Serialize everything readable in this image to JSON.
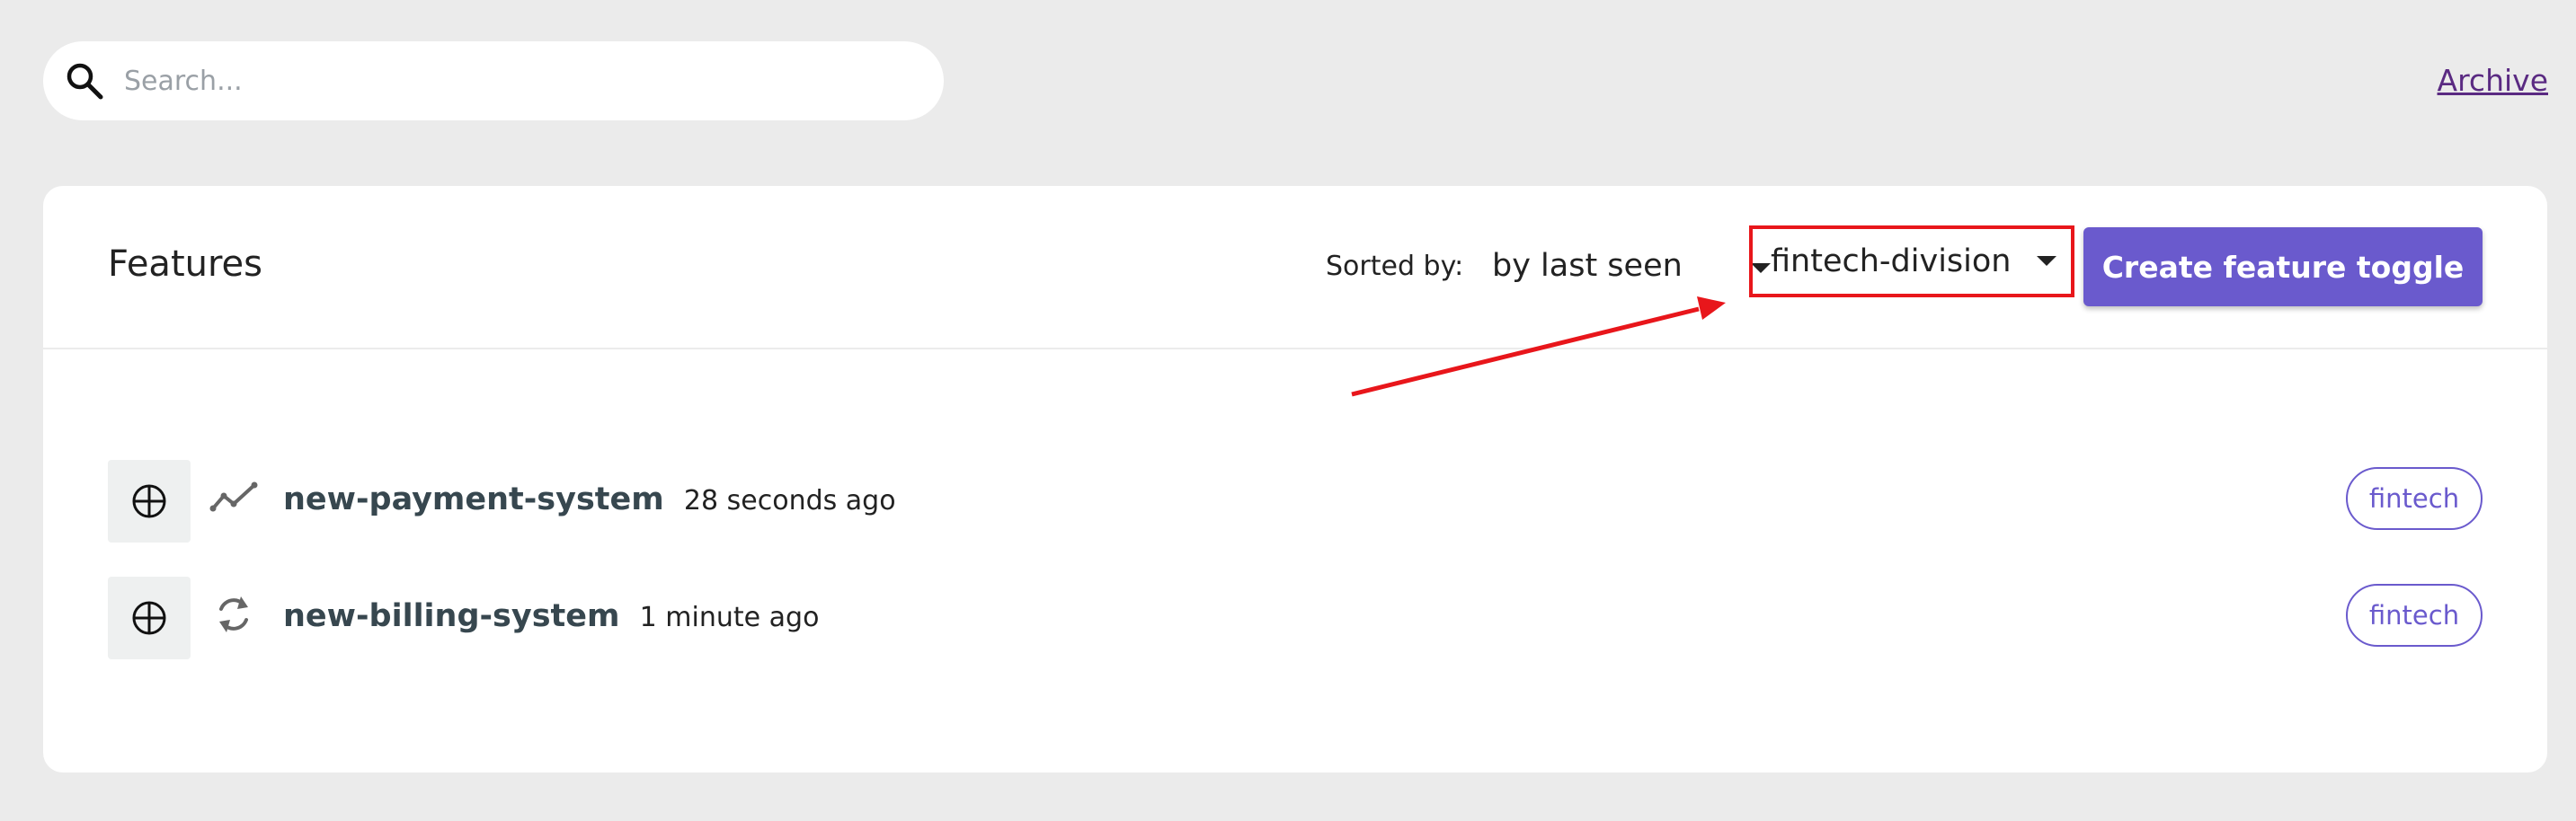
{
  "search": {
    "placeholder": "Search...",
    "icon": "search-icon"
  },
  "header_links": {
    "archive_label": "Archive"
  },
  "features": {
    "title": "Features",
    "sorted_by_label": "Sorted by:",
    "sort_value": "by last seen",
    "project_value": "fintech-division",
    "create_button_label": "Create feature toggle",
    "items": [
      {
        "name": "new-payment-system",
        "last_seen": "28 seconds ago",
        "type_icon": "trending-up-icon",
        "project": "fintech"
      },
      {
        "name": "new-billing-system",
        "last_seen": "1 minute ago",
        "type_icon": "sync-icon",
        "project": "fintech"
      }
    ]
  },
  "colors": {
    "accent": "#6a5acd",
    "highlight": "#e8161b",
    "background": "#ebebeb"
  }
}
